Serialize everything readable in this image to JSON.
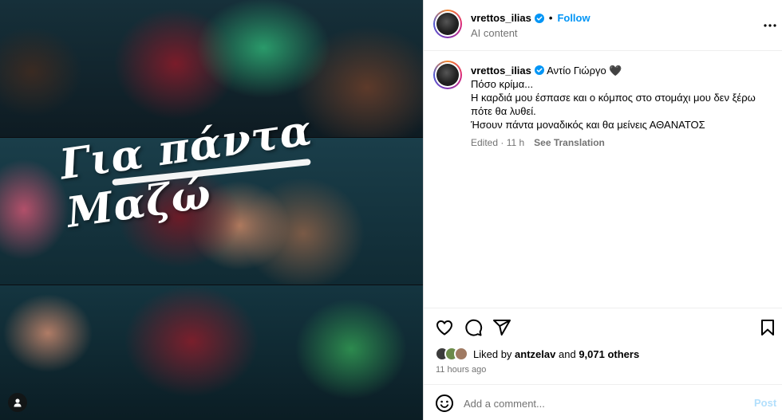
{
  "post": {
    "image": {
      "overlay_text": "Για πάντα Μαζώ",
      "user_tag_icon": "user-tag-icon"
    },
    "header": {
      "username": "vrettos_ilias",
      "separator": "•",
      "follow_label": "Follow",
      "subtitle": "AI content"
    },
    "caption": {
      "username": "vrettos_ilias",
      "first_line": "Αντίο Γιώργο 🖤",
      "lines": [
        "Πόσο κρίμα...",
        "Η καρδιά μου έσπασε και ο κόμπος στο στομάχι μου δεν ξέρω πότε θα λυθεί.",
        "Ήσουν πάντα μοναδικός και θα μείνεις ΑΘΑΝΑΤΟΣ"
      ],
      "edited": "Edited · 11 h",
      "see_translation": "See Translation"
    },
    "actions": {
      "liked_by_prefix": "Liked by",
      "liked_by_user": "antzelav",
      "liked_by_and": "and",
      "others": "9,071 others",
      "time_ago": "11 hours ago"
    },
    "comment": {
      "placeholder": "Add a comment...",
      "post_label": "Post"
    },
    "colors": {
      "accent": "#0095f6",
      "muted": "#737373",
      "post_disabled": "#b2dffc",
      "verified": "#0095f6"
    }
  }
}
